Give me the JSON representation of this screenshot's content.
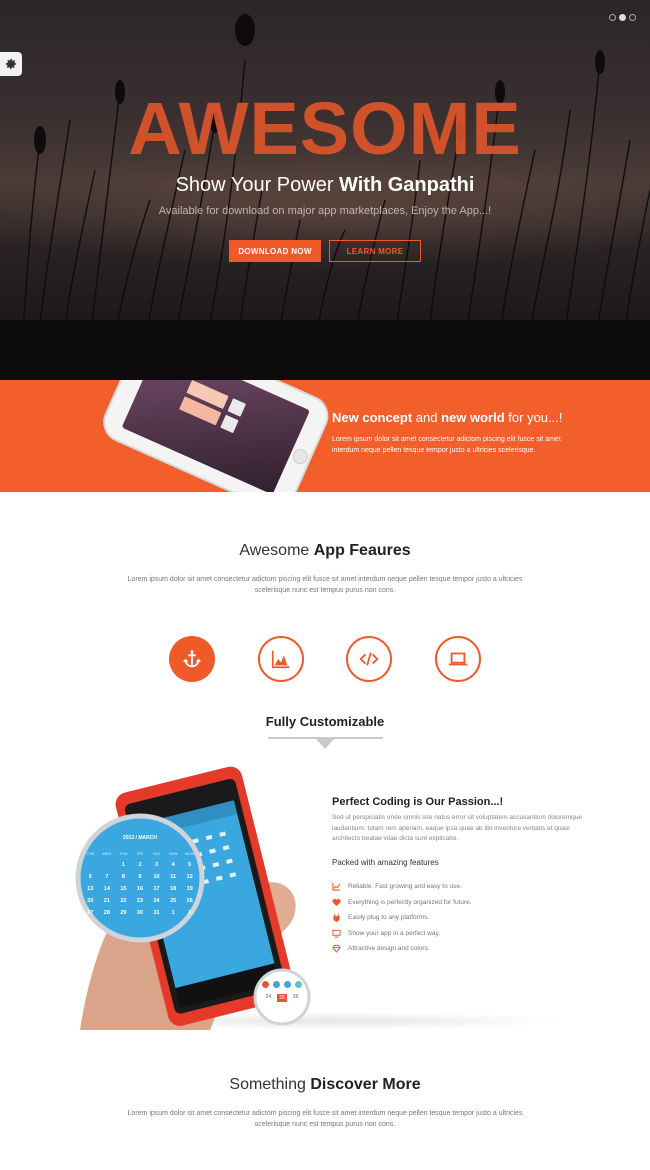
{
  "hero": {
    "title": "AWESOME",
    "subtitle_light": "Show Your Power ",
    "subtitle_bold": "With Ganpathi",
    "description": "Available for download on major app marketplaces, Enjoy the App...!",
    "download_label": "DOWNLOAD NOW",
    "learn_label": "LEARN MORE",
    "slider_dots": 3,
    "slider_active": 1
  },
  "band": {
    "title_bold_1": "New concept",
    "title_light_1": " and ",
    "title_bold_2": "new world",
    "title_light_2": " for you...!",
    "text": "Lorem ipsum dolor sit amet consectetur adictom piscing elit fusce sit amet interdum neque pellen tesque tempor justo a ultricies scelerisque."
  },
  "features": {
    "title_light": "Awesome ",
    "title_bold": "App Feaures",
    "text": "Lorem ipsum dolor sit amet consectetur adictom piscing elit fusce sit amet interdum neque pellen tesque tempor justo a ultricies scelerisque nunc est tempus purus non cons.",
    "icons": [
      "anchor-icon",
      "chart-icon",
      "code-icon",
      "laptop-icon"
    ],
    "custom_title": "Fully Customizable"
  },
  "phone_screen": {
    "calendar_header": "2013 / MARCH",
    "weekdays": [
      "TUE",
      "WED",
      "THU",
      "FRI",
      "SAT",
      "SUN",
      "MON"
    ],
    "dates": [
      "1",
      "2",
      "3",
      "4",
      "5",
      "6",
      "7",
      "8",
      "9",
      "10",
      "11",
      "12",
      "13",
      "14",
      "15",
      "16",
      "17",
      "18",
      "19",
      "20",
      "21",
      "22",
      "23",
      "24",
      "25",
      "26",
      "27",
      "28",
      "29",
      "30",
      "31",
      "1",
      "2"
    ],
    "zoom_dates": [
      "24",
      "25",
      "26"
    ]
  },
  "passion": {
    "title": "Perfect Coding is Our Passion...!",
    "text": "Sed ut perspiciatis unde omnis iste natus error sit voluptatem accusantium doloremque laudantium, totam rem aperiam, eaque ipsa quae ab illo inventore veritatis et quasi architecto beatae vitae dicta sunt explicabo.",
    "packed_title": "Packed with amazing features",
    "items": [
      {
        "icon": "chart-line-icon",
        "text": "Reliable, Fast growing and easy to use."
      },
      {
        "icon": "heart-icon",
        "text": "Everything is perfectly organized for future."
      },
      {
        "icon": "plug-icon",
        "text": "Easily plug to any platforms."
      },
      {
        "icon": "monitor-icon",
        "text": "Show your app in a perfect way."
      },
      {
        "icon": "diamond-icon",
        "text": "Attractive design and colors."
      }
    ]
  },
  "discover": {
    "title_light": "Something ",
    "title_bold": "Discover More",
    "text": "Lorem ipsum dolor sit amet consectetur adictom piscing elit fusce sit amet interdum neque pellen tesque tempor justo a ultricies scelerisque nunc est tempus purus non cons."
  },
  "colors": {
    "accent": "#f05a28",
    "band": "#f25f2b",
    "calendar_blue": "#3aa7e0"
  }
}
